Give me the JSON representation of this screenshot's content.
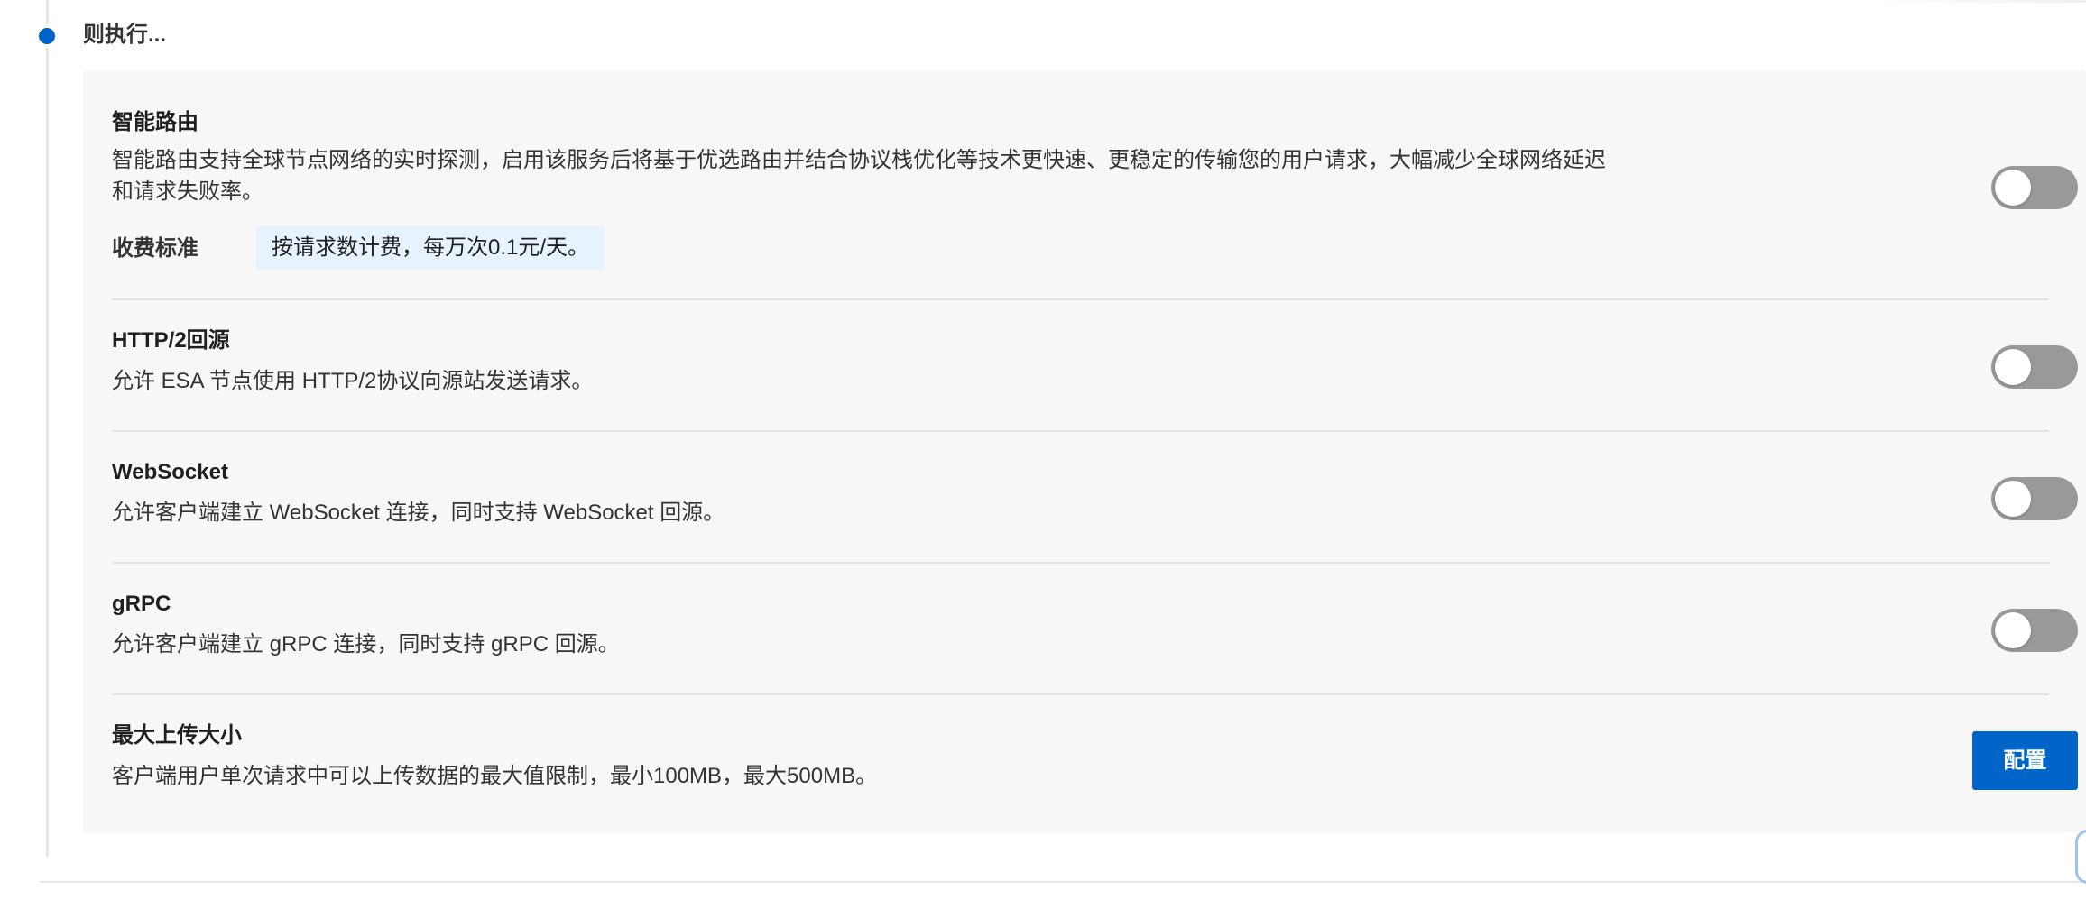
{
  "step": {
    "title": "则执行..."
  },
  "items": [
    {
      "title": "智能路由",
      "description": "智能路由支持全球节点网络的实时探测，启用该服务后将基于优选路由并结合协议栈优化等技术更快速、更稳定的传输您的用户请求，大幅减少全球网络延迟和请求失败率。",
      "description_line1": "智能路由支持全球节点网络的实时探测，启用该服务后将基于优选路由并结合协议栈优化等技术更快速、更稳定的传输您的用户请求，大幅减少全球网络延迟",
      "description_line2": "和请求失败率。",
      "fee_label": "收费标准",
      "fee_value": "按请求数计费，每万次0.1元/天。",
      "toggle_on": false
    },
    {
      "title": "HTTP/2回源",
      "description": "允许 ESA 节点使用 HTTP/2协议向源站发送请求。",
      "toggle_on": false
    },
    {
      "title": "WebSocket",
      "description": "允许客户端建立 WebSocket 连接，同时支持 WebSocket 回源。",
      "toggle_on": false
    },
    {
      "title": "gRPC",
      "description": "允许客户端建立 gRPC 连接，同时支持 gRPC 回源。",
      "toggle_on": false
    },
    {
      "title": "最大上传大小",
      "description": "客户端用户单次请求中可以上传数据的最大值限制，最小100MB，最大500MB。",
      "button_label": "配置"
    }
  ],
  "colors": {
    "accent": "#0064c8",
    "toggle_off": "#999999",
    "panel_bg": "#f7f7f7",
    "fee_bg": "#e6f2fd"
  },
  "icons": {
    "timeline_marker": "timeline-dot-icon"
  }
}
